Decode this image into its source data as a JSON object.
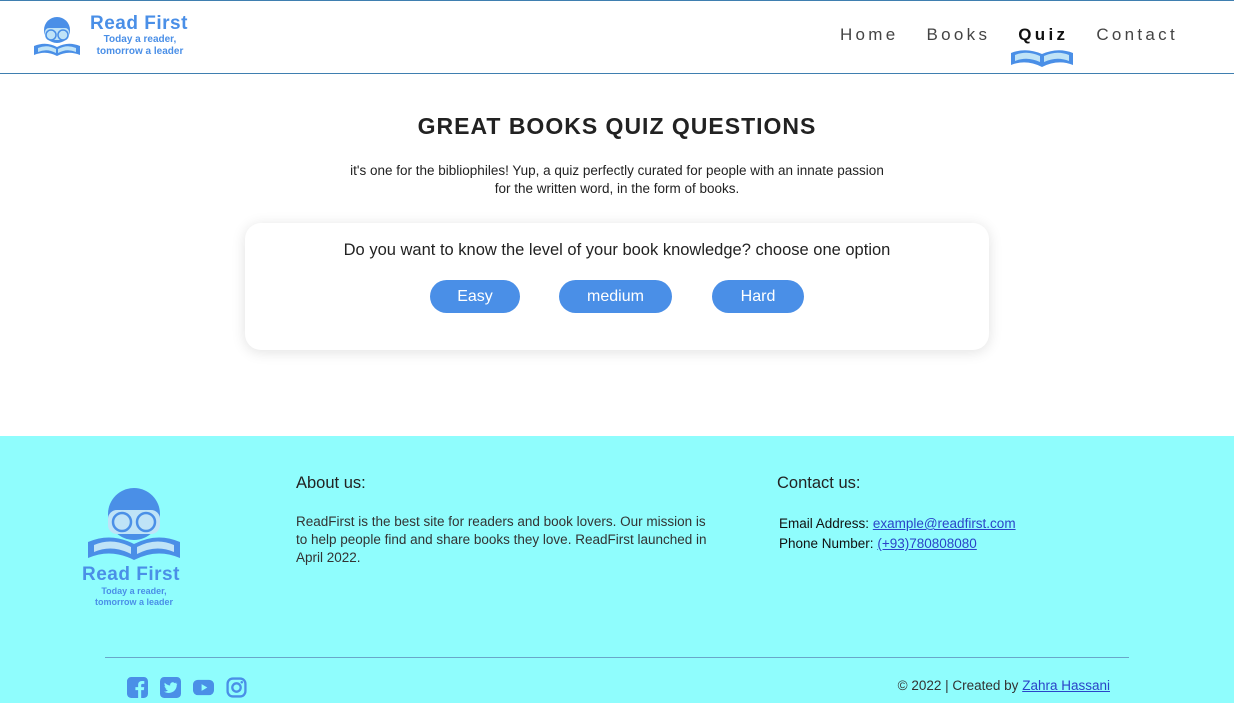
{
  "brand": {
    "name": "Read First",
    "tagline": "Today a reader, tomorrow a leader",
    "color": "#4a8fe7"
  },
  "nav": {
    "items": [
      {
        "label": "Home",
        "active": false
      },
      {
        "label": "Books",
        "active": false
      },
      {
        "label": "Quiz",
        "active": true
      },
      {
        "label": "Contact",
        "active": false
      }
    ]
  },
  "main": {
    "title": "GREAT BOOKS QUIZ QUESTIONS",
    "intro": "it's one for the bibliophiles! Yup, a quiz perfectly curated for people with an innate passion for the written word, in the form of books.",
    "question": "Do you want to know the level of your book knowledge? choose one option",
    "options": [
      "Easy",
      "medium",
      "Hard"
    ]
  },
  "footer": {
    "about": {
      "heading": "About us:",
      "text": "ReadFirst is the best site for readers and book lovers. Our mission is to help people find and share books they love. ReadFirst launched in April 2022."
    },
    "contact": {
      "heading": "Contact us:",
      "email_label": "Email Address:",
      "email": "example@readfirst.com",
      "phone_label": "Phone Number:",
      "phone": "(+93)780808080"
    },
    "socials": [
      "facebook-icon",
      "twitter-icon",
      "youtube-icon",
      "instagram-icon"
    ],
    "copyright_prefix": "© 2022 | Created by",
    "author": "Zahra Hassani",
    "background": "#8ffdfd"
  }
}
